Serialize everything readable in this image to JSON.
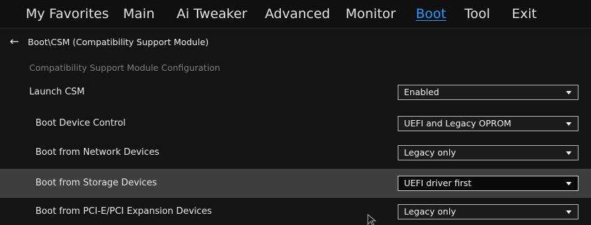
{
  "menu": {
    "items": [
      {
        "label": "My Favorites"
      },
      {
        "label": "Main"
      },
      {
        "label": "Ai Tweaker"
      },
      {
        "label": "Advanced"
      },
      {
        "label": "Monitor"
      },
      {
        "label": "Boot"
      },
      {
        "label": "Tool"
      },
      {
        "label": "Exit"
      }
    ],
    "active": "Boot",
    "active_color": "#1aa0ff"
  },
  "breadcrumb": {
    "icon": "back-arrow-icon",
    "glyph": "←",
    "text": "Boot\\CSM (Compatibility Support Module)"
  },
  "section_title": "Compatibility Support Module Configuration",
  "settings": [
    {
      "label": "Launch CSM",
      "value": "Enabled"
    },
    {
      "label": "Boot Device Control",
      "value": "UEFI and Legacy OPROM"
    },
    {
      "label": "Boot from Network Devices",
      "value": "Legacy only"
    },
    {
      "label": "Boot from Storage Devices",
      "value": "UEFI driver first",
      "selected": true
    },
    {
      "label": "Boot from PCI-E/PCI Expansion Devices",
      "value": "Legacy only"
    }
  ],
  "colors": {
    "highlight_row": "#3e3e3e",
    "panel": "#141414",
    "menubar": "#101010"
  }
}
